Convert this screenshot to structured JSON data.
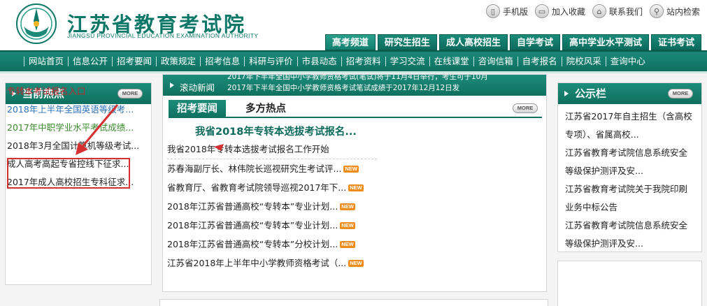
{
  "site": {
    "title": "江苏省教育考试院",
    "subtitle": "JIANGSU PROVINCIAL EDUCATION EXAMINATION AUTHORITY"
  },
  "quick_links": [
    {
      "label": "手机版",
      "icon": "mobile-icon"
    },
    {
      "label": "加入收藏",
      "icon": "bookmark-icon"
    },
    {
      "label": "联系我们",
      "icon": "contact-icon"
    },
    {
      "label": "站内检索",
      "icon": "search-icon"
    }
  ],
  "top_tabs": [
    "高考频道",
    "研究生招生",
    "成人高校招生",
    "自学考试",
    "高中学业水平测试",
    "证书考试"
  ],
  "nav_items": [
    "网站首页",
    "信息公开",
    "招考要闻",
    "政策规定",
    "招考信息",
    "科研与评价",
    "市县动态",
    "招考资料",
    "学习交流",
    "在线课堂",
    "咨询信箱",
    "自考报名",
    "院校风采",
    "查询中心"
  ],
  "left_panel": {
    "title": "当前热点",
    "more": "MORE",
    "items": [
      {
        "text": "专转本考试报名入口",
        "color": "#c0282e"
      },
      {
        "text": "2018年上半年全国英语等级考...",
        "color": "#2a6fb5"
      },
      {
        "text": "2017年中职学业水平考试成绩...",
        "color": "#3a8a2c"
      },
      {
        "text": "2018年3月全国计算机等级考试...",
        "color": "#222222"
      },
      {
        "text": "成人高考高起专省控线下征求...",
        "color": "#222222"
      },
      {
        "text": "2017年成人高校招生专科征求...",
        "color": "#222222"
      }
    ]
  },
  "center_panel": {
    "ticker_label": "滚动新闻",
    "ticker_line1": "2017年下半年全国中小学教师资格考试(笔试)将于11月4日举行，考生可于10月",
    "ticker_line2": "2017年下半年全国中小学教师资格考试笔试成绩于2017年12月12日发",
    "tab_active": "招考要闻",
    "tab_inactive": "多方热点",
    "more": "MORE",
    "headline": "我省2018年专转本选拔考试报名...",
    "news": [
      {
        "text": "我省2018年专转本选拔考试报名工作开始",
        "new": false
      },
      {
        "text": "苏春海副厅长、林伟院长巡视研究生考试评...",
        "new": true
      },
      {
        "text": "省教育厅、省教育考试院领导巡视2017年下...",
        "new": true
      },
      {
        "text": "2018年江苏省普通高校“专转本”专业计划...",
        "new": true
      },
      {
        "text": "2018年江苏省普通高校“专转本”专业计划...",
        "new": true
      },
      {
        "text": "2018年江苏省普通高校“专转本”分校计划...",
        "new": true
      },
      {
        "text": "江苏省2018年上半年中小学教师资格考试（...",
        "new": true
      }
    ],
    "new_badge": "NEW"
  },
  "right_panel": {
    "title": "公示栏",
    "more": "MORE",
    "items": [
      "江苏省2017年自主招生（含高校专项）、省属高校...",
      "江苏省教育考试院信息系统安全等级保护测评及安...",
      "江苏省教育考试院关于我院印刷业务中标公告",
      "江苏省教育考试院信息系统安全等级保护测评及安..."
    ]
  },
  "colors": {
    "brand": "#0f705f",
    "highlight": "#d62f2f",
    "new_badge": "#f08c1a"
  }
}
